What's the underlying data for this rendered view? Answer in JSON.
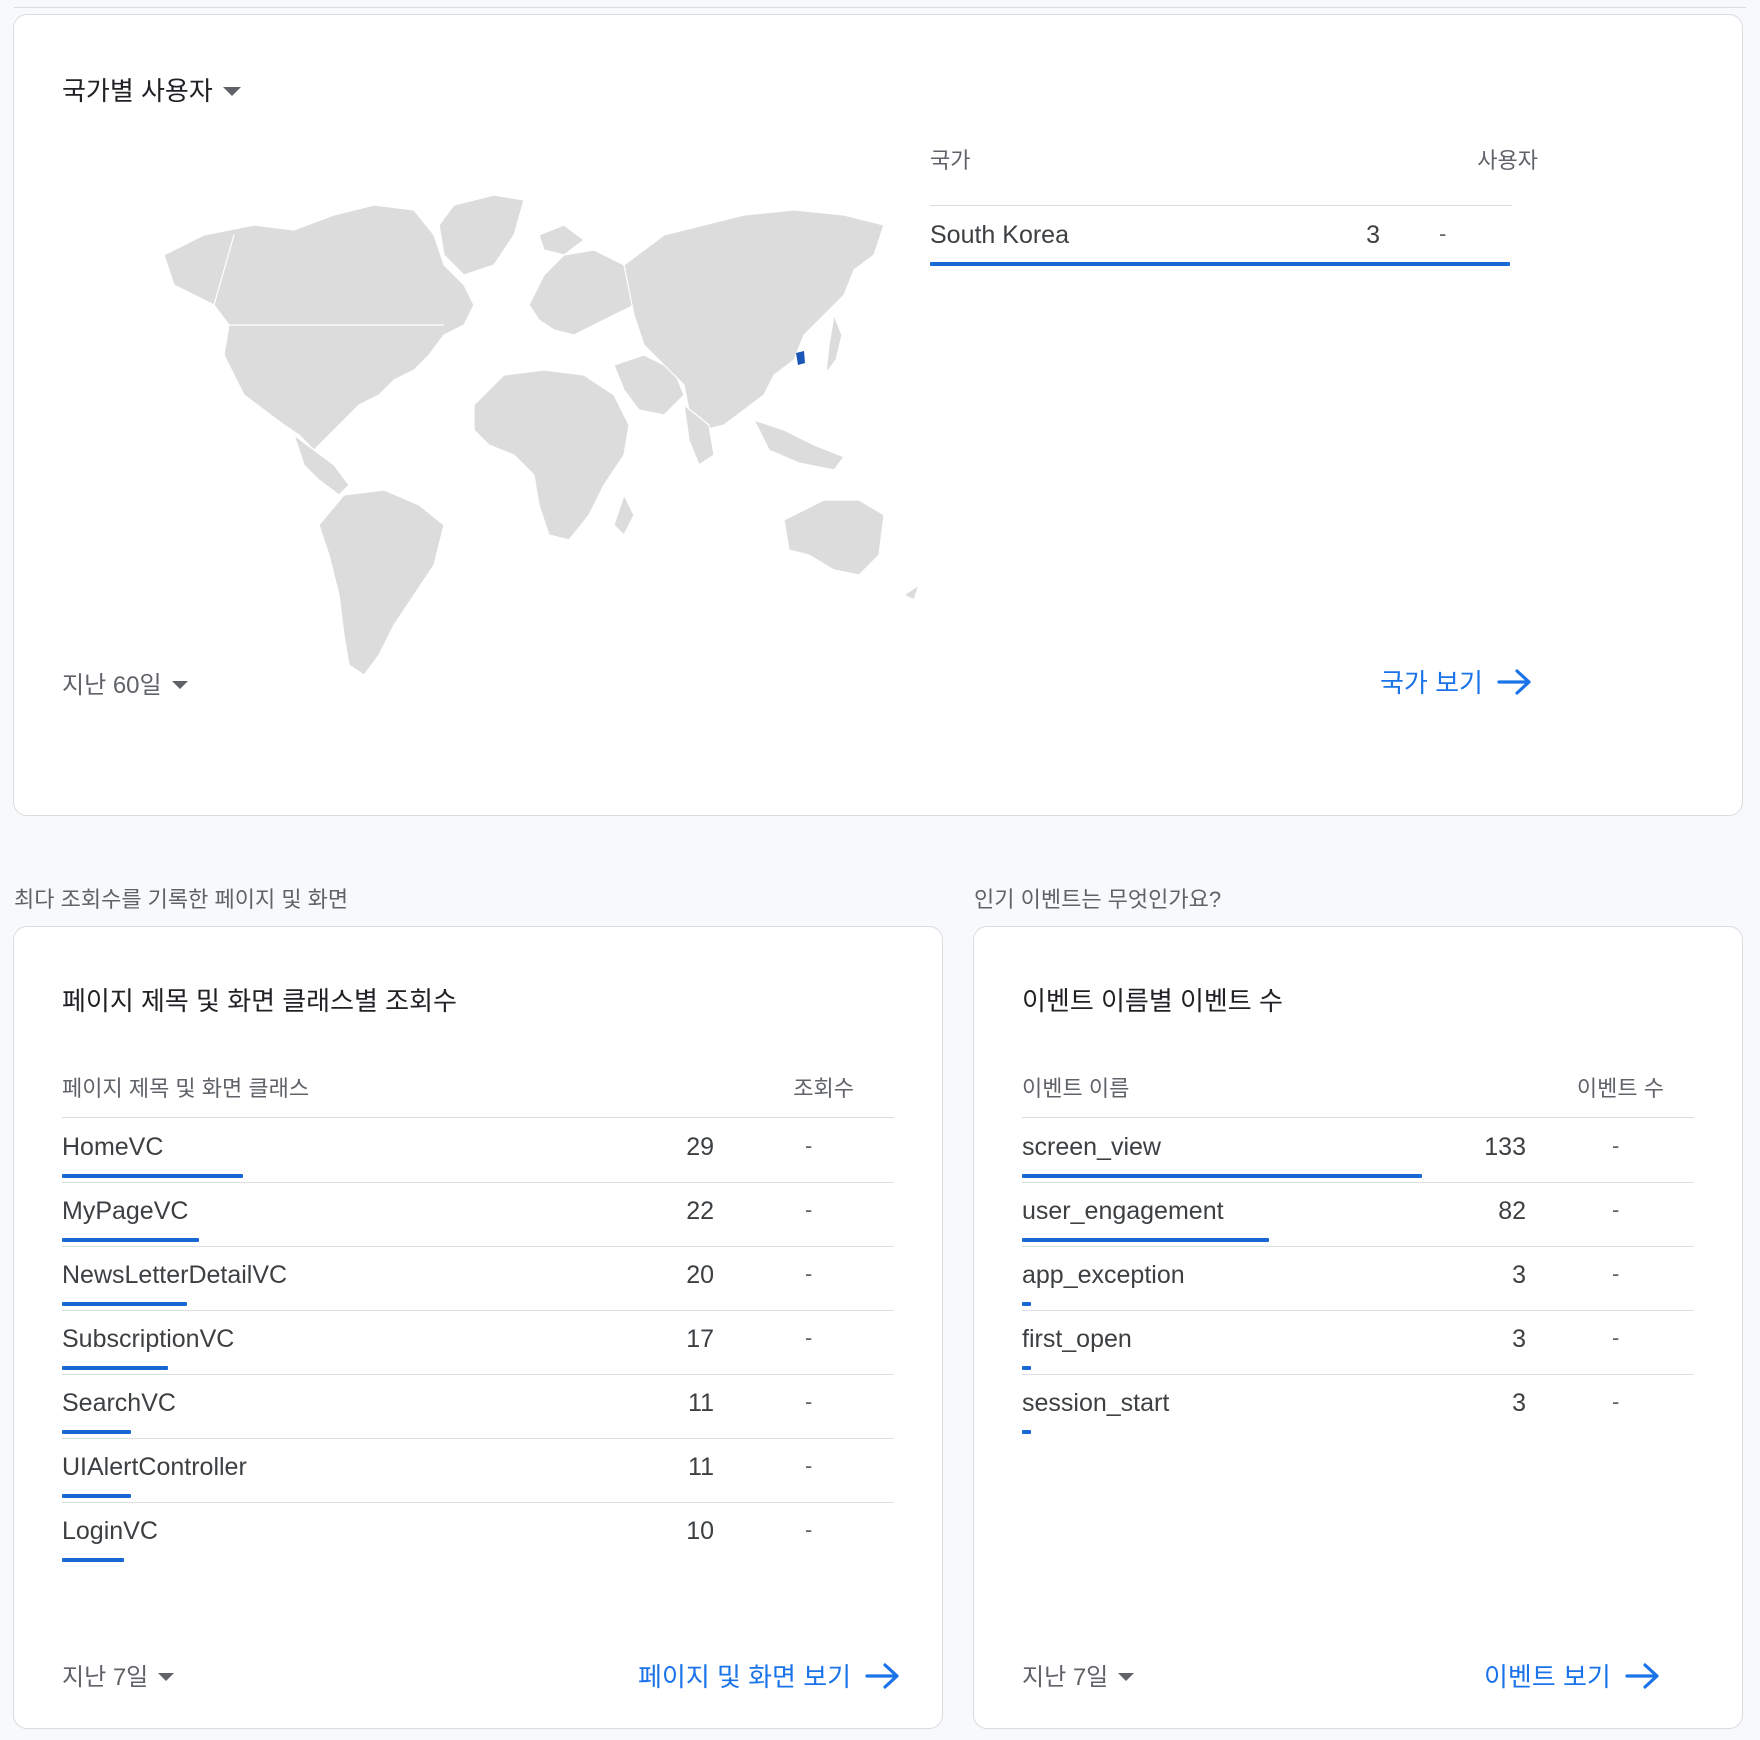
{
  "country_card": {
    "title": "국가별 사용자",
    "col_country": "국가",
    "col_users": "사용자",
    "rows": [
      {
        "name": "South Korea",
        "value": "3",
        "change": "-",
        "bar_fraction": 1.0
      }
    ],
    "range": "지난 60일",
    "view_link": "국가 보기",
    "highlight_color": "#1a56b8",
    "land_color": "#dcdcdc"
  },
  "pages_section": {
    "label": "최다 조회수를 기록한 페이지 및 화면",
    "card_title": "페이지 제목 및 화면 클래스별 조회수",
    "col_name": "페이지 제목 및 화면 클래스",
    "col_value": "조회수",
    "rows": [
      {
        "name": "HomeVC",
        "value": "29",
        "change": "-",
        "bar_fraction": 0.218
      },
      {
        "name": "MyPageVC",
        "value": "22",
        "change": "-",
        "bar_fraction": 0.165
      },
      {
        "name": "NewsLetterDetailVC",
        "value": "20",
        "change": "-",
        "bar_fraction": 0.15
      },
      {
        "name": "SubscriptionVC",
        "value": "17",
        "change": "-",
        "bar_fraction": 0.128
      },
      {
        "name": "SearchVC",
        "value": "11",
        "change": "-",
        "bar_fraction": 0.083
      },
      {
        "name": "UIAlertController",
        "value": "11",
        "change": "-",
        "bar_fraction": 0.083
      },
      {
        "name": "LoginVC",
        "value": "10",
        "change": "-",
        "bar_fraction": 0.075
      }
    ],
    "range": "지난 7일",
    "view_link": "페이지 및 화면 보기"
  },
  "events_section": {
    "label": "인기 이벤트는 무엇인가요?",
    "card_title": "이벤트 이름별 이벤트 수",
    "col_name": "이벤트 이름",
    "col_value": "이벤트 수",
    "rows": [
      {
        "name": "screen_view",
        "value": "133",
        "change": "-",
        "bar_fraction": 1.0
      },
      {
        "name": "user_engagement",
        "value": "82",
        "change": "-",
        "bar_fraction": 0.617
      },
      {
        "name": "app_exception",
        "value": "3",
        "change": "-",
        "bar_fraction": 0.023
      },
      {
        "name": "first_open",
        "value": "3",
        "change": "-",
        "bar_fraction": 0.023
      },
      {
        "name": "session_start",
        "value": "3",
        "change": "-",
        "bar_fraction": 0.023
      }
    ],
    "range": "지난 7일",
    "view_link": "이벤트 보기"
  }
}
